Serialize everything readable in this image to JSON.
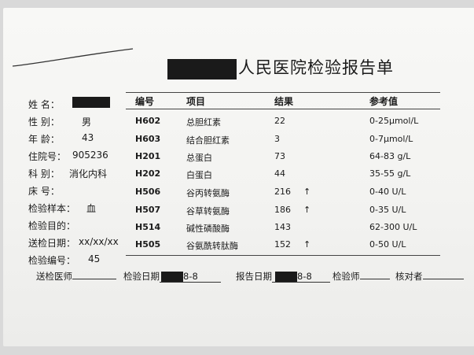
{
  "report": {
    "title": "人民医院检验报告单"
  },
  "patient": {
    "name_label": "姓  名：",
    "sex_label": "性  别：",
    "sex": "男",
    "age_label": "年  龄：",
    "age": "43",
    "inpatient_no_label": "住院号：",
    "inpatient_no": "905236",
    "dept_label": "科  别：",
    "dept": "消化内科",
    "bed_label": "床  号：",
    "sample_label": "检验样本：",
    "sample": "血",
    "purpose_label": "检验目的：",
    "send_date_label": "送检日期：",
    "send_date": "xx/xx/xx",
    "test_no_label": "检验编号：",
    "test_no": "45"
  },
  "table": {
    "headers": {
      "code": "编号",
      "item": "项目",
      "result": "结果",
      "reference": "参考值"
    },
    "rows": [
      {
        "code": "H602",
        "item": "总胆红素",
        "result": "22",
        "flag": "",
        "reference": "0-25μmol/L"
      },
      {
        "code": "H603",
        "item": "结合胆红素",
        "result": "3",
        "flag": "",
        "reference": "0-7μmol/L"
      },
      {
        "code": "H201",
        "item": "总蛋白",
        "result": "73",
        "flag": "",
        "reference": "64-83 g/L"
      },
      {
        "code": "H202",
        "item": "白蛋白",
        "result": "44",
        "flag": "",
        "reference": "35-55 g/L"
      },
      {
        "code": "H506",
        "item": "谷丙转氨酶",
        "result": "216",
        "flag": "↑",
        "reference": "0-40 U/L"
      },
      {
        "code": "H507",
        "item": "谷草转氨酶",
        "result": "186",
        "flag": "↑",
        "reference": "0-35 U/L"
      },
      {
        "code": "H514",
        "item": "碱性磷酸酶",
        "result": "143",
        "flag": "",
        "reference": "62-300 U/L"
      },
      {
        "code": "H505",
        "item": "谷氨酰转肽酶",
        "result": "152",
        "flag": "↑",
        "reference": "0-50 U/L"
      }
    ]
  },
  "footer": {
    "sender_label": "送检医师",
    "test_date_label": "检验日期",
    "test_date": "8-8",
    "report_date_label": "报告日期",
    "report_date": "8-8",
    "tester_label": "检验师",
    "checker_label": "核对者"
  }
}
